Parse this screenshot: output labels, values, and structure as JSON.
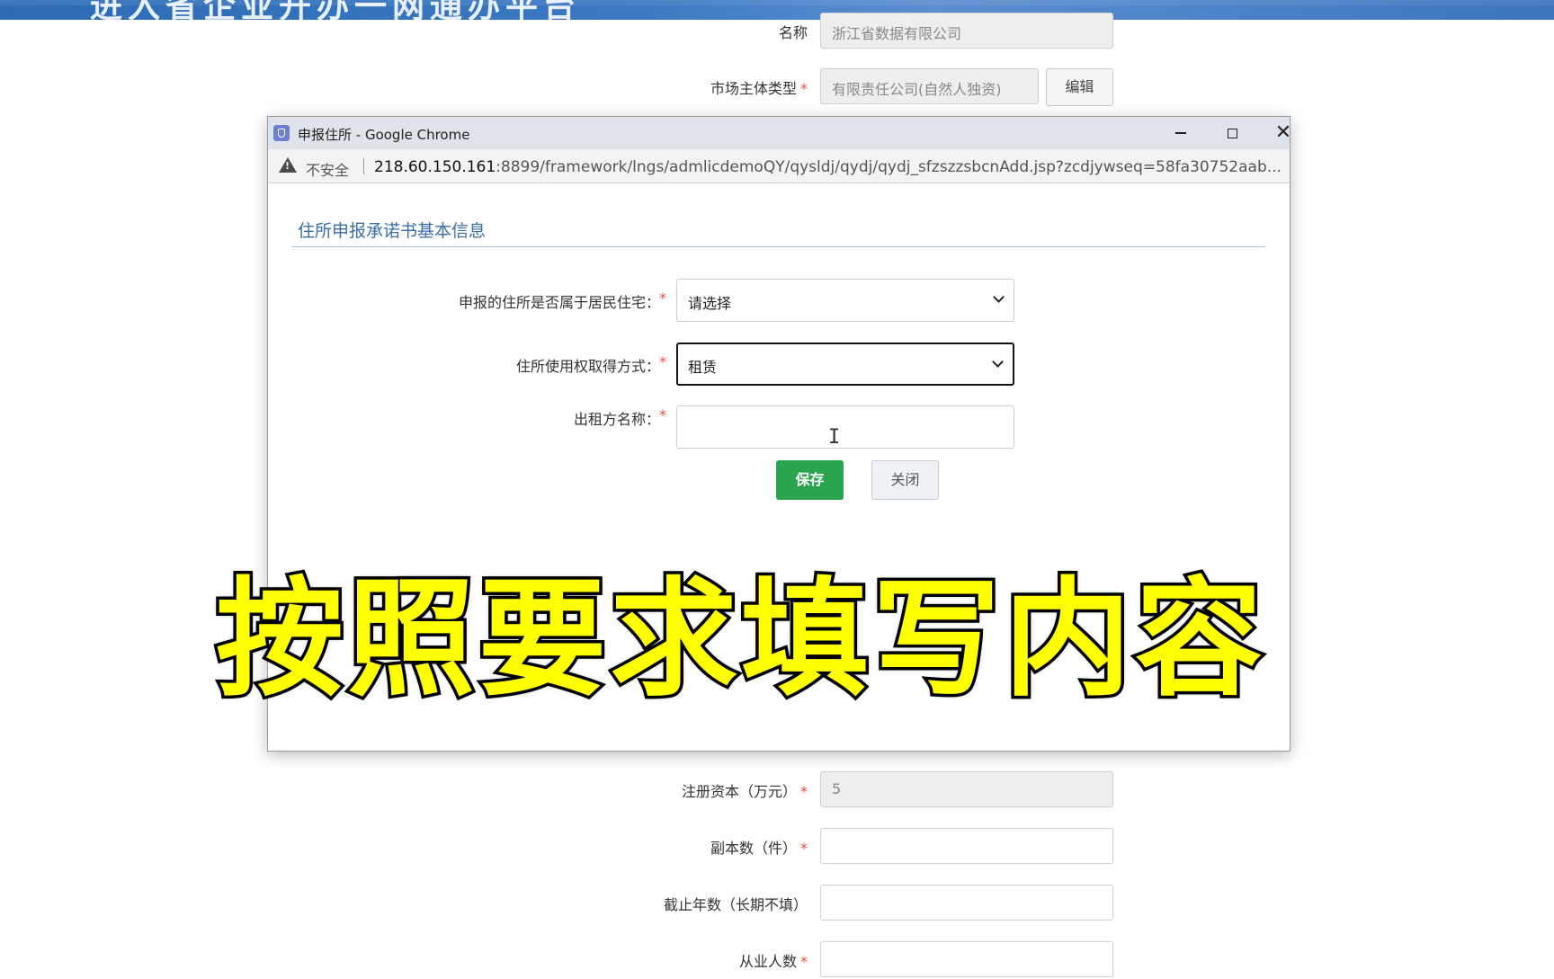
{
  "banner": {
    "title_fragment": "进入省企业开办一网通办平台"
  },
  "background_form": {
    "name_label": "名称",
    "name_value": "浙江省数据有限公司",
    "market_type_label": "市场主体类型",
    "market_type_value": "有限责任公司(自然人独资)",
    "edit_label": "编辑",
    "reg_capital_label": "注册资本（万元）",
    "reg_capital_value": "5",
    "copies_label": "副本数（件）",
    "years_label": "截止年数（长期不填）",
    "employees_label": "从业人数",
    "required_mark": "*"
  },
  "popup": {
    "window_title": "申报住所 - Google Chrome",
    "insecure_label": "不安全",
    "url_host": "218.60.150.161",
    "url_path": ":8899/framework/lngs/admlicdemoQY/qysldj/qydj/qydj_sfzszzsbcnAdd.jsp?zcdjywseq=58fa30752aab...",
    "section_title": "住所申报承诺书基本信息",
    "fields": [
      {
        "label": "申报的住所是否属于居民住宅：",
        "value": "请选择"
      },
      {
        "label": "住所使用权取得方式：",
        "value": "租赁"
      },
      {
        "label": "出租方名称：",
        "value": ""
      }
    ],
    "required_mark": "*",
    "save_label": "保存",
    "close_label": "关闭"
  },
  "caption": "按照要求填写内容",
  "icons": {
    "favicon": "shield-icon",
    "minimize": "minimize-icon",
    "maximize": "maximize-icon",
    "close": "close-icon",
    "warning": "warning-icon",
    "dropdown": "chevron-down-icon",
    "cursor": "text-cursor-icon"
  },
  "colors": {
    "banner": "#3b78c2",
    "required": "#e74c3c",
    "save_button": "#2aa44f",
    "section_title": "#3a6ea5",
    "caption_fill": "#ffff00"
  }
}
